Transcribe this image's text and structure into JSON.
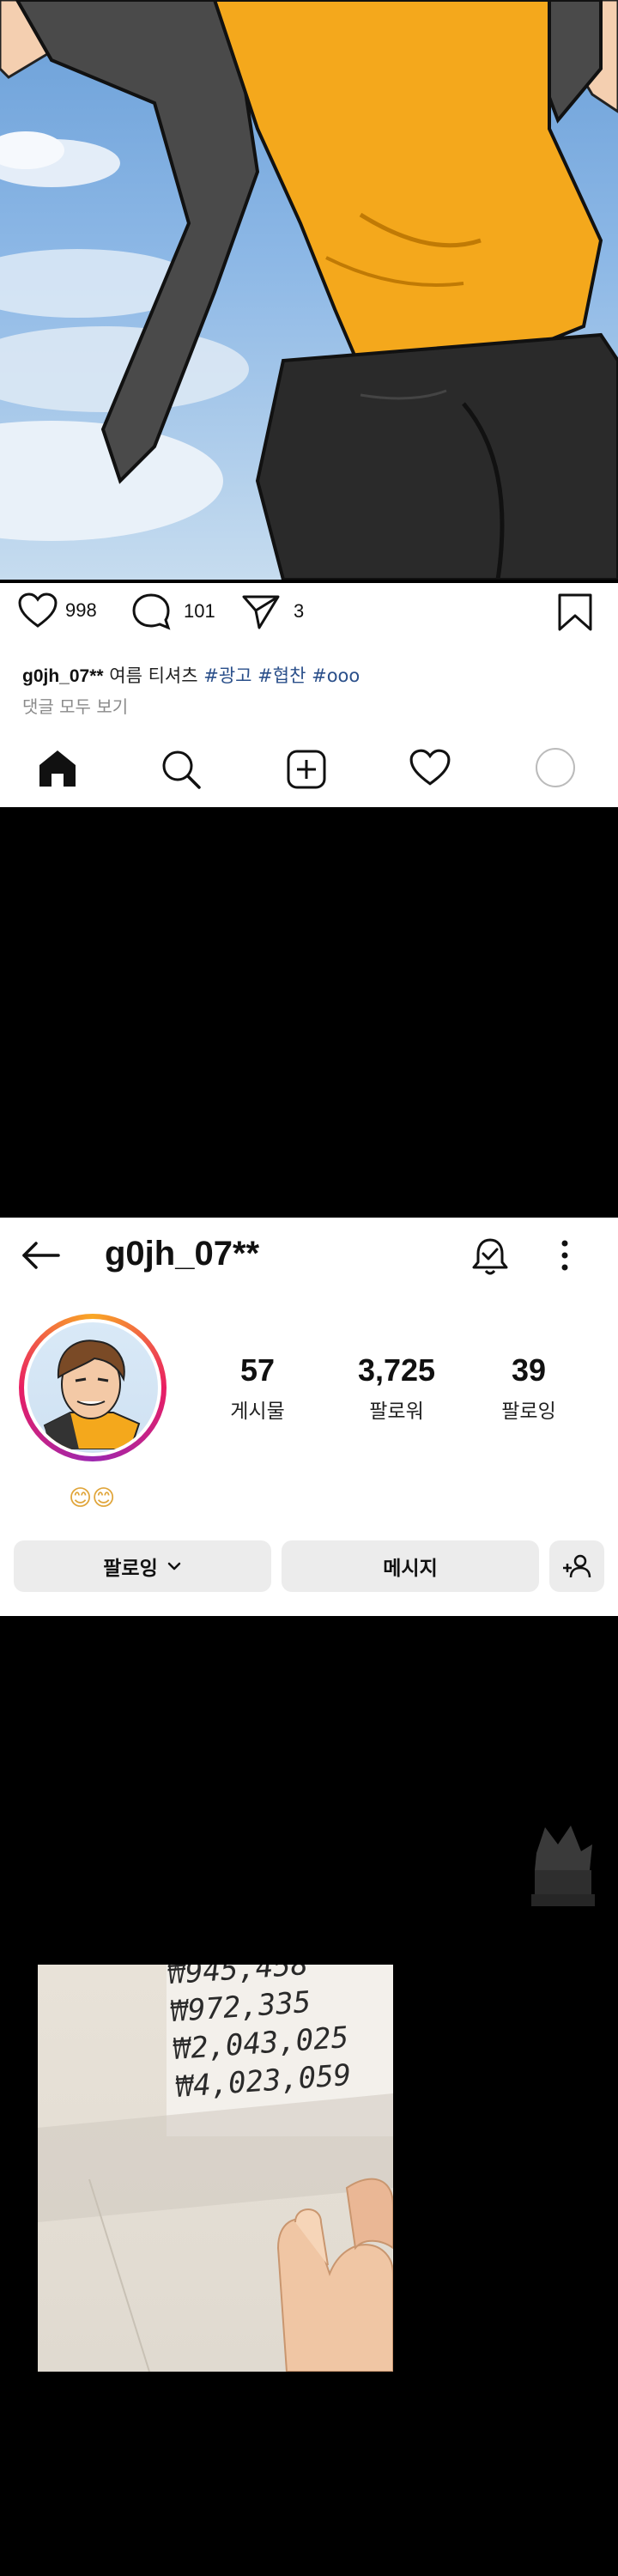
{
  "post": {
    "likes": "998",
    "comments": "101",
    "shares": "3",
    "caption_user": "g0jh_07**",
    "caption_text": "여름 티셔츠",
    "hashtags": [
      "#광고",
      "#협찬",
      "#ooo"
    ],
    "view_comments": "댓글 모두 보기"
  },
  "navbar": {
    "icons": [
      "home-icon",
      "search-icon",
      "add-post-icon",
      "activity-heart-icon",
      "profile-icon"
    ]
  },
  "profile": {
    "username": "g0jh_07**",
    "stats": [
      {
        "value": "57",
        "label": "게시물"
      },
      {
        "value": "3,725",
        "label": "팔로워"
      },
      {
        "value": "39",
        "label": "팔로잉"
      }
    ],
    "bio": "😊😊",
    "buttons": {
      "following": "팔로잉",
      "message": "메시지"
    }
  },
  "ledger": {
    "amounts": [
      "₩945,458",
      "₩972,335",
      "₩2,043,025",
      "₩4,023,059"
    ]
  },
  "colors": {
    "shirt": "#f4a81c",
    "shorts": "#2a2a2a",
    "sky": "#8db8e6",
    "hashtag": "#2a4f8a",
    "button_bg": "#ececec"
  }
}
